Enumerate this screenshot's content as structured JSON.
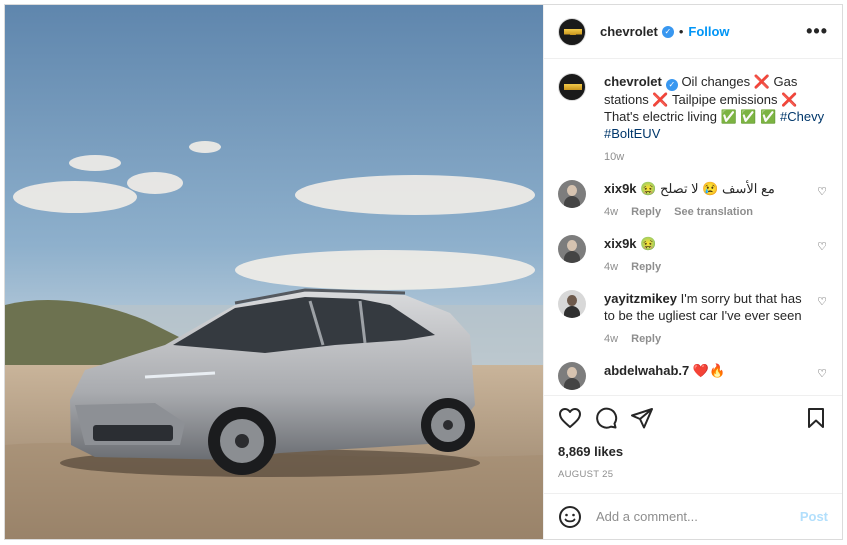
{
  "post": {
    "username": "chevrolet",
    "follow_label": "Follow",
    "more_label": "•••",
    "dot": "•",
    "image_alt": "Silver Chevrolet Bolt EUV parked on a sandy beach under a blue sky with clouds"
  },
  "caption": {
    "username": "chevrolet",
    "text": "Oil changes ❌ Gas stations ❌ Tailpipe emissions ❌ That's electric living ✅ ✅ ✅",
    "hashtags": "#Chevy #BoltEUV",
    "age": "10w"
  },
  "comments": [
    {
      "username": "xix9k",
      "text": "مع الأسف 😢 لا تصلح 🤢",
      "age": "4w",
      "reply": "Reply",
      "translate": "See translation"
    },
    {
      "username": "xix9k",
      "text": "🤢",
      "age": "4w",
      "reply": "Reply"
    },
    {
      "username": "yayitzmikey",
      "text": "I'm sorry but that has to be the ugliest car I've ever seen",
      "age": "4w",
      "reply": "Reply"
    },
    {
      "username": "abdelwahab.7",
      "text": "❤️🔥"
    }
  ],
  "footer": {
    "likes": "8,869 likes",
    "date": "August 25",
    "comment_placeholder": "Add a comment...",
    "post_label": "Post"
  },
  "colors": {
    "accent": "#0095f6",
    "verified": "#3897f0",
    "hashtag": "#00376b",
    "muted": "#8e8e8e"
  },
  "icons": [
    "heart-icon",
    "comment-icon",
    "share-icon",
    "bookmark-icon",
    "emoji-icon",
    "verified-icon",
    "more-icon"
  ]
}
